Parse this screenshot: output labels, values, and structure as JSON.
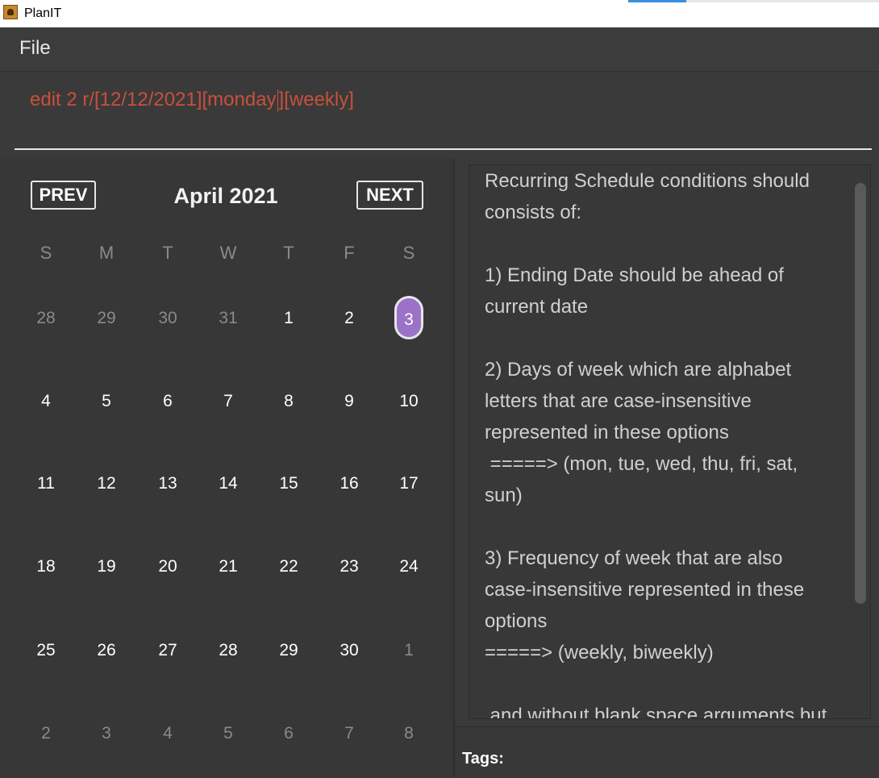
{
  "window": {
    "title": "PlanIT"
  },
  "menu": {
    "file": "File"
  },
  "command": {
    "before": "edit 2 r/[12/12/2021][monday",
    "after": "][weekly]"
  },
  "calendar": {
    "prev": "PREV",
    "next": "NEXT",
    "month_title": "April 2021",
    "weekdays": [
      "S",
      "M",
      "T",
      "W",
      "T",
      "F",
      "S"
    ],
    "weeks": [
      [
        "28",
        "29",
        "30",
        "31",
        "1",
        "2",
        "3"
      ],
      [
        "4",
        "5",
        "6",
        "7",
        "8",
        "9",
        "10"
      ],
      [
        "11",
        "12",
        "13",
        "14",
        "15",
        "16",
        "17"
      ],
      [
        "18",
        "19",
        "20",
        "21",
        "22",
        "23",
        "24"
      ],
      [
        "25",
        "26",
        "27",
        "28",
        "29",
        "30",
        "1"
      ],
      [
        "2",
        "3",
        "4",
        "5",
        "6",
        "7",
        "8"
      ]
    ],
    "selected_day": "3",
    "selected_color": "#9b72c8"
  },
  "result": {
    "text": "Recurring Schedule conditions should consists of:\n\n1) Ending Date should be ahead of current date\n\n2) Days of week which are alphabet letters that are case-insensitive represented in these options\n =====> (mon, tue, wed, thu, fri, sat, sun)\n\n3) Frequency of week that are also case-insensitive represented in these options\n=====> (weekly, biweekly)\n\n and without blank space arguments but"
  },
  "tags": {
    "label": "Tags:"
  }
}
